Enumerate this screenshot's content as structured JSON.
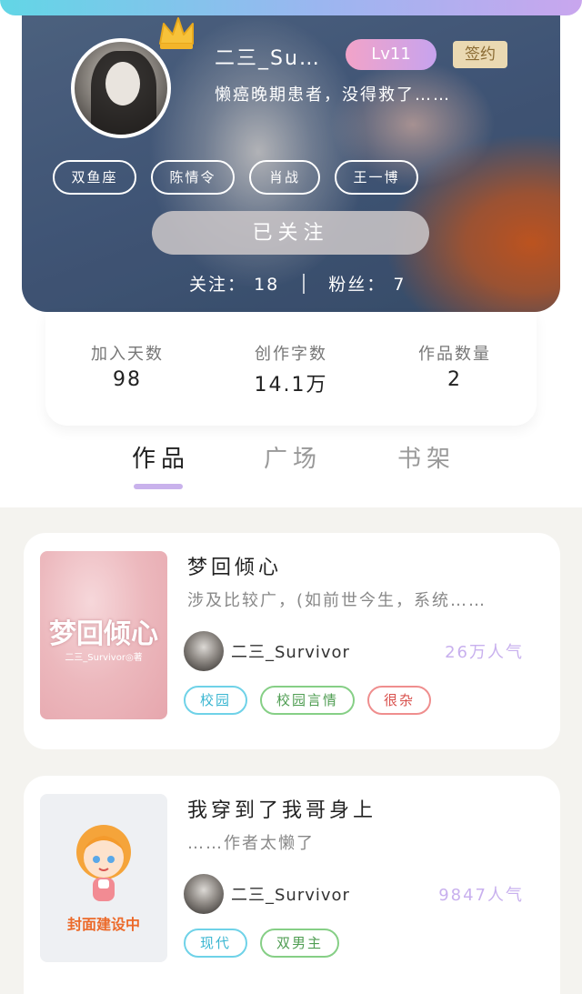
{
  "profile": {
    "username": "二三_Su…",
    "level": "Lv11",
    "sign_badge": "签约",
    "bio": "懒癌晚期患者，没得救了……",
    "tags": [
      "双鱼座",
      "陈情令",
      "肖战",
      "王一博"
    ],
    "follow_button": "已关注",
    "following_label": "关注：",
    "following_count": "18",
    "fans_label": "粉丝：",
    "fans_count": "7"
  },
  "stats": [
    {
      "label": "加入天数",
      "value": "98"
    },
    {
      "label": "创作字数",
      "value": "14.1万"
    },
    {
      "label": "作品数量",
      "value": "2"
    }
  ],
  "tabs": [
    {
      "label": "作品",
      "active": true
    },
    {
      "label": "广场",
      "active": false
    },
    {
      "label": "书架",
      "active": false
    }
  ],
  "works": [
    {
      "title": "梦回倾心",
      "description": "涉及比较广，(如前世今生，系统……",
      "cover_title": "梦回倾心",
      "cover_subtitle": "二三_Survivor◎著",
      "author": "二三_Survivor",
      "popularity": "26万人气",
      "tags": [
        "校园",
        "校园言情",
        "很杂"
      ]
    },
    {
      "title": "我穿到了我哥身上",
      "description": "……作者太懒了",
      "cover_text": "封面建设中",
      "author": "二三_Survivor",
      "popularity": "9847人气",
      "tags": [
        "现代",
        "双男主"
      ]
    }
  ],
  "colors": {
    "accent_purple": "#c9b2ec",
    "level_gradient": [
      "#f2a3c8",
      "#c7a3ee"
    ],
    "tag_blue": "#6fd2e8",
    "tag_green": "#86cf86",
    "tag_red": "#ef8e8e"
  }
}
